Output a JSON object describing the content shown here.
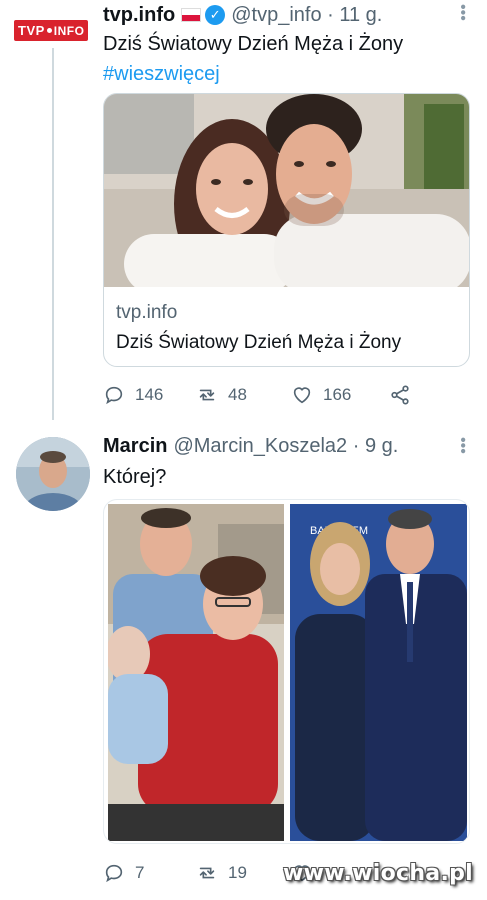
{
  "tweets": [
    {
      "avatar_logo": {
        "tvp": "TVP",
        "info": "INFO"
      },
      "name": "tvp.info",
      "handle": "@tvp_info · 11 g.",
      "text": "Dziś Światowy Dzień Męża i Żony",
      "hashtag": "#wieszwięcej",
      "card": {
        "domain": "tvp.info",
        "title": "Dziś Światowy Dzień Męża i Żony"
      },
      "replies": "146",
      "retweets": "48",
      "likes": "166"
    },
    {
      "name": "Marcin",
      "handle": "@Marcin_Koszela2 · 9 g.",
      "text": "Której?",
      "replies": "7",
      "retweets": "19",
      "likes": ""
    }
  ],
  "right_photo_banner": "BAR... ZEM",
  "watermark": "www.wiocha.pl",
  "colors": {
    "accent": "#1d9bf0",
    "tvp_red": "#d9232d",
    "muted": "#536471"
  }
}
